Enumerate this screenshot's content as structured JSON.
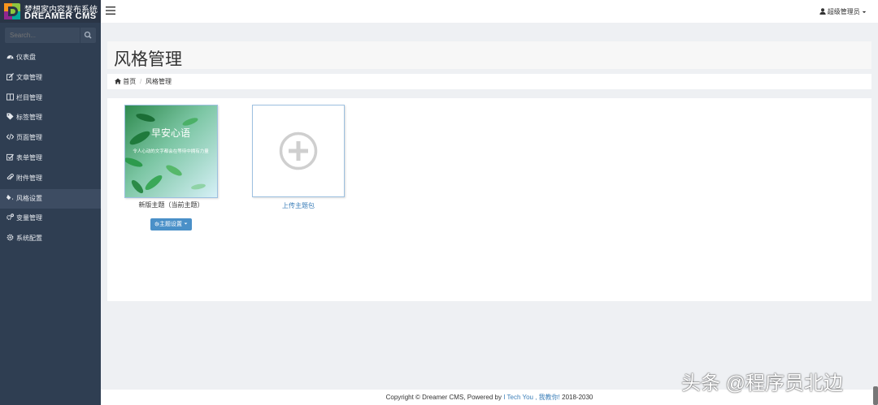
{
  "brand": {
    "title_cn": "梦想家内容发布系统",
    "title_en": "DREAMER CMS"
  },
  "search": {
    "placeholder": "Search..."
  },
  "sidebar": {
    "items": [
      {
        "label": "仪表盘",
        "icon": "dashboard-icon"
      },
      {
        "label": "文章管理",
        "icon": "edit-icon"
      },
      {
        "label": "栏目管理",
        "icon": "columns-icon"
      },
      {
        "label": "标签管理",
        "icon": "tags-icon"
      },
      {
        "label": "页面管理",
        "icon": "code-icon"
      },
      {
        "label": "表单管理",
        "icon": "checkbox-icon"
      },
      {
        "label": "附件管理",
        "icon": "paperclip-icon"
      },
      {
        "label": "风格设置",
        "icon": "paint-icon",
        "active": true
      },
      {
        "label": "变量管理",
        "icon": "gears-icon"
      },
      {
        "label": "系统配置",
        "icon": "gear-icon"
      }
    ]
  },
  "topbar": {
    "user": "超级管理员"
  },
  "page": {
    "title": "风格管理"
  },
  "breadcrumb": {
    "home": "首页",
    "separator": "/",
    "current": "风格管理"
  },
  "themes": [
    {
      "label": "新版主题（当前主题）",
      "button": "主题设置",
      "thumbnail_text": "早安心语",
      "thumbnail_subtext": "令人心动的文字都会在等待中拥有力量"
    }
  ],
  "upload": {
    "label": "上传主题包"
  },
  "footer": {
    "text_before": "Copyright © Dreamer CMS, Powered by",
    "link": "I Tech You , 我教你!",
    "text_after": "2018-2030"
  },
  "watermark": {
    "text": "头条 @程序员北边"
  },
  "colors": {
    "sidebar": "#2f3e52",
    "accent": "#4a90c8",
    "link": "#3c7fb9"
  }
}
